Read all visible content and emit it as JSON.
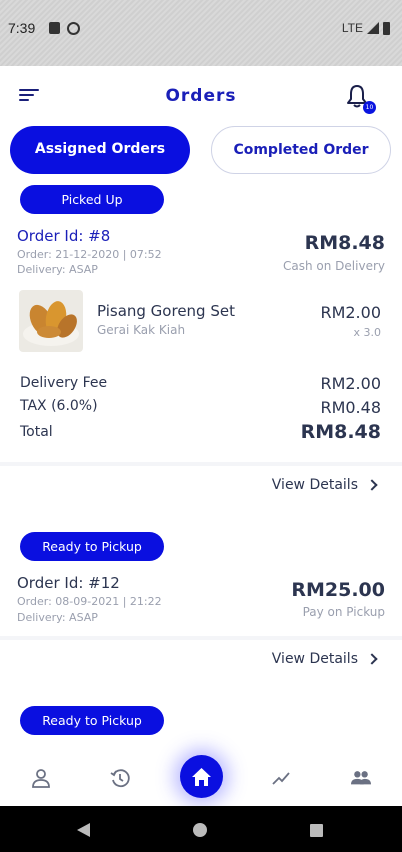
{
  "status_bar": {
    "time": "7:39",
    "network": "LTE"
  },
  "app_bar": {
    "title": "Orders",
    "notification_count": "10"
  },
  "tabs": [
    {
      "label": "Assigned Orders",
      "active": true
    },
    {
      "label": "Completed Order",
      "active": false
    }
  ],
  "orders": [
    {
      "status": "Picked Up",
      "order_id": "Order Id: #8",
      "order_time": "Order: 21-12-2020 | 07:52",
      "delivery": "Delivery: ASAP",
      "amount": "RM8.48",
      "payment_method": "Cash on Delivery",
      "item": {
        "name": "Pisang Goreng Set",
        "shop": "Gerai Kak Kiah",
        "price": "RM2.00",
        "qty": "x 3.0"
      },
      "delivery_fee_label": "Delivery Fee",
      "delivery_fee": "RM2.00",
      "tax_label": "TAX (6.0%)",
      "tax": "RM0.48",
      "total_label": "Total",
      "total": "RM8.48",
      "view_details": "View Details"
    },
    {
      "status": "Ready to Pickup",
      "order_id": "Order Id: #12",
      "order_time": "Order: 08-09-2021 | 21:22",
      "delivery": "Delivery: ASAP",
      "amount": "RM25.00",
      "payment_method": "Pay on Pickup",
      "view_details": "View Details"
    },
    {
      "status": "Ready to Pickup"
    }
  ],
  "bottom_nav": [
    "profile-icon",
    "history-icon",
    "home-icon",
    "analytics-icon",
    "users-icon"
  ],
  "colors": {
    "primary": "#0a0fe0",
    "title": "#1a1fb8",
    "text": "#2c3550",
    "muted": "#9a9fae"
  }
}
